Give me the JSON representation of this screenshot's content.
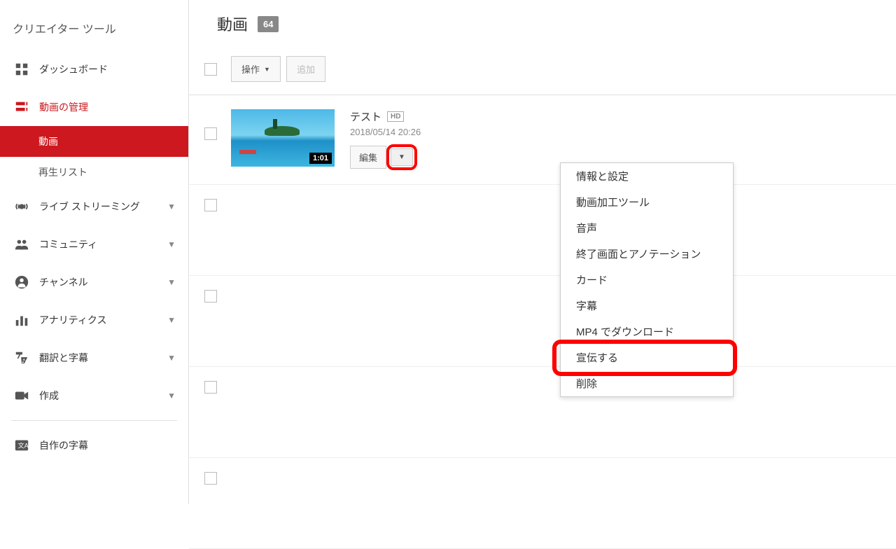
{
  "sidebar": {
    "title": "クリエイター ツール",
    "items": [
      {
        "label": "ダッシュボード",
        "icon": "dashboard"
      },
      {
        "label": "動画の管理",
        "icon": "video-manager",
        "active": true
      },
      {
        "label": "ライブ ストリーミング",
        "icon": "live"
      },
      {
        "label": "コミュニティ",
        "icon": "community"
      },
      {
        "label": "チャンネル",
        "icon": "channel"
      },
      {
        "label": "アナリティクス",
        "icon": "analytics"
      },
      {
        "label": "翻訳と字幕",
        "icon": "translate"
      },
      {
        "label": "作成",
        "icon": "create"
      },
      {
        "label": "自作の字幕",
        "icon": "own-subtitles"
      }
    ],
    "sub_items": {
      "videos": "動画",
      "playlists": "再生リスト"
    }
  },
  "page": {
    "title": "動画",
    "count": "64"
  },
  "toolbar": {
    "actions_label": "操作",
    "add_label": "追加"
  },
  "video": {
    "title": "テスト",
    "hd_badge": "HD",
    "date": "2018/05/14 20:26",
    "duration": "1:01",
    "edit_label": "編集"
  },
  "dropdown": {
    "items": [
      "情報と設定",
      "動画加工ツール",
      "音声",
      "終了画面とアノテーション",
      "カード",
      "字幕",
      "MP4 でダウンロード",
      "宣伝する",
      "削除"
    ]
  }
}
